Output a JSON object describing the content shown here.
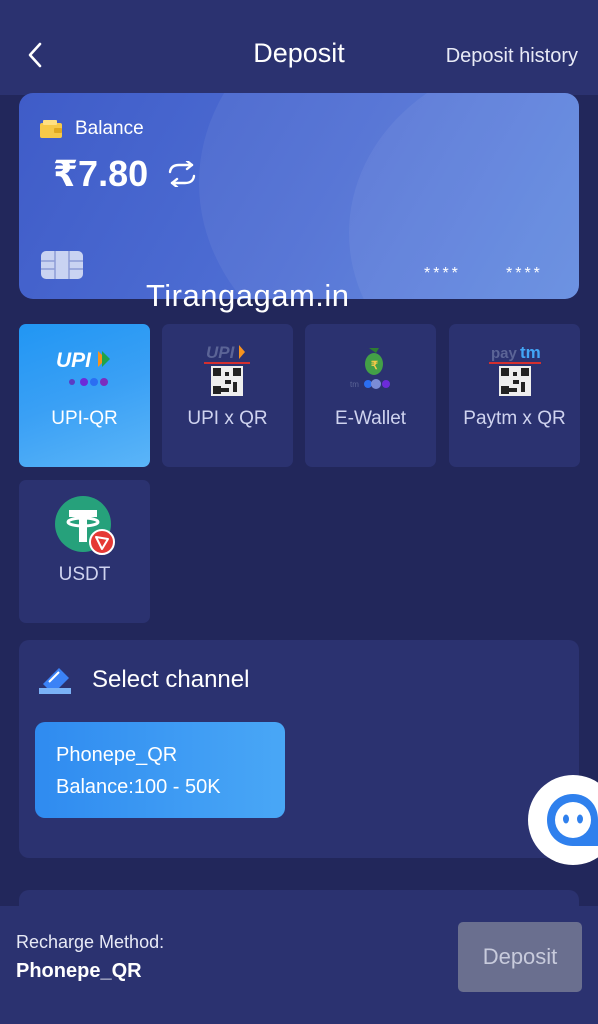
{
  "header": {
    "title": "Deposit",
    "history_link": "Deposit history"
  },
  "balance_card": {
    "label": "Balance",
    "amount": "₹7.80",
    "card_mask_1": "****",
    "card_mask_2": "****"
  },
  "watermark": "Tirangagam.in",
  "payment_methods": [
    {
      "label": "UPI-QR",
      "icon": "upi-icon",
      "selected": true
    },
    {
      "label": "UPI x QR",
      "icon": "upi-qr-icon",
      "selected": false
    },
    {
      "label": "E-Wallet",
      "icon": "e-wallet-icon",
      "selected": false
    },
    {
      "label": "Paytm x QR",
      "icon": "paytm-qr-icon",
      "selected": false
    },
    {
      "label": "USDT",
      "icon": "usdt-icon",
      "selected": false
    }
  ],
  "channel": {
    "title": "Select channel",
    "options": [
      {
        "name": "Phonepe_QR",
        "range": "Balance:100 - 50K"
      }
    ]
  },
  "bottom_bar": {
    "caption": "Recharge Method:",
    "value": "Phonepe_QR",
    "button_label": "Deposit"
  },
  "colors": {
    "background": "#22275b",
    "panel": "#2b3270",
    "accent_blue": "#2f8bf0",
    "button_disabled": "#6a6f8f"
  }
}
